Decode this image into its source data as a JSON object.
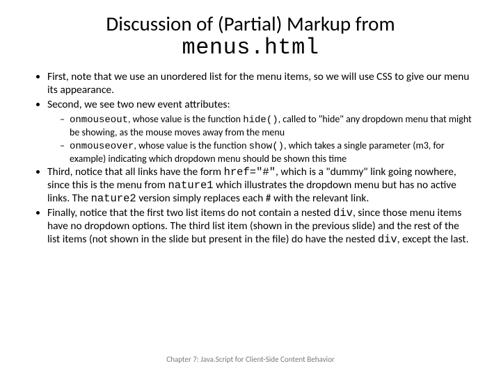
{
  "title_top": "Discussion of (Partial) Markup from",
  "title_code": "menus.html",
  "bullets": {
    "b1": "First, note that we use an unordered list for the menu items, so we will use CSS to give our menu its appearance.",
    "b2": "Second, we see two new event attributes:",
    "b2a_code1": "onmouseout",
    "b2a_mid": ", whose value is the function ",
    "b2a_code2": "hide()",
    "b2a_rest": ", called to \"hide\" any dropdown menu that might be showing, as the mouse moves away from the menu",
    "b2b_code1": "onmouseover",
    "b2b_mid": ", whose value is the function ",
    "b2b_code2": "show()",
    "b2b_rest": ", which takes a single parameter (m3, for example) indicating which dropdown menu should be shown this time",
    "b3_pre": "Third, notice that all links have the form ",
    "b3_code1": "href=\"#\"",
    "b3_mid1": ", which is a \"dummy\" link going nowhere, since this is the menu from ",
    "b3_code2": "nature1",
    "b3_mid2": " which illustrates the dropdown menu but has no active links. The ",
    "b3_code3": "nature2",
    "b3_rest": " version simply replaces each # with the relevant link.",
    "b4_pre": "Finally, notice that the first two list items do not contain a nested ",
    "b4_code1": "div",
    "b4_mid": ", since those menu items have no dropdown options. The third list item (shown in the previous slide) and the rest of the list items (not shown in the slide but present in the file) do have the nested ",
    "b4_code2": "div",
    "b4_rest": ", except the last."
  },
  "footer": "Chapter 7: Java.Script for Client-Side Content Behavior"
}
